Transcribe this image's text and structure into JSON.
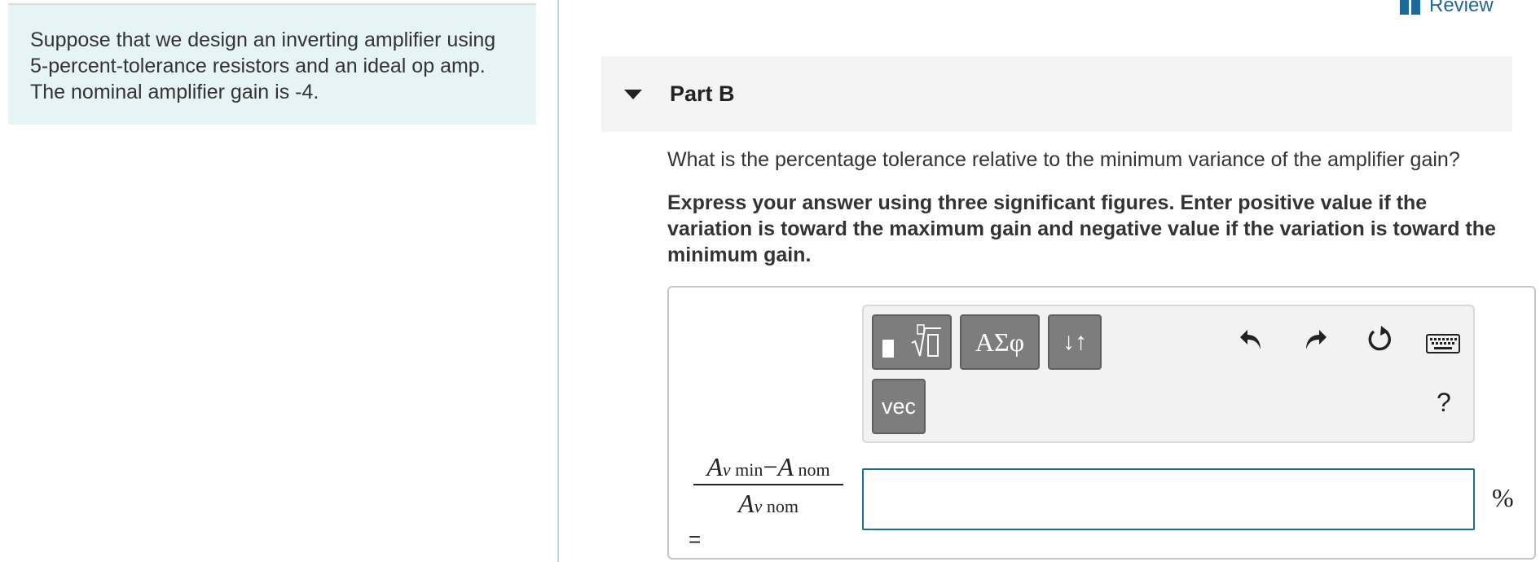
{
  "intro": {
    "text": "Suppose that we design an inverting amplifier using 5-percent-tolerance resistors and an ideal op amp. The nominal amplifier gain is -4."
  },
  "header": {
    "review_label": "Review"
  },
  "part": {
    "title": "Part B",
    "question": "What is the percentage tolerance relative to the minimum variance of the amplifier gain?",
    "instructions": "Express your answer using three significant figures. Enter positive value if the variation is toward the maximum gain and negative value if the variation is toward the minimum gain."
  },
  "toolbar": {
    "greek_label": "ΑΣφ",
    "arrows_label": "↓↑",
    "vec_label": "vec",
    "help_label": "?",
    "icons": [
      "templates-icon",
      "undo-icon",
      "redo-icon",
      "reset-icon",
      "keyboard-icon"
    ]
  },
  "answer": {
    "lhs": {
      "num_a": "A",
      "num_a_sub_v": "v",
      "num_a_sub": " min",
      "minus": "−",
      "num_b": "A",
      "num_b_sub": " nom",
      "den_a": "A",
      "den_a_sub_v": "v",
      "den_a_sub": " nom",
      "equals": "="
    },
    "value": "",
    "unit": "%"
  },
  "colors": {
    "intro_bg": "#e6f4f5",
    "link": "#1c6a9a",
    "input_border": "#1a6e8e",
    "button_gray": "#7d7d7d"
  }
}
